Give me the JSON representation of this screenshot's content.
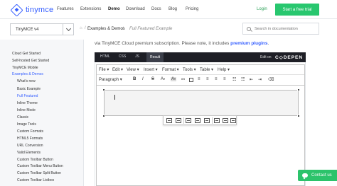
{
  "brand": {
    "name": "tinymce",
    "color": "#335dff",
    "accent": "#28c76f"
  },
  "nav": {
    "items": [
      "Features",
      "Extensions",
      "Demo",
      "Download",
      "Docs",
      "Blog",
      "Pricing"
    ],
    "active": "Demo",
    "login": "Login",
    "cta": "Start a free trial"
  },
  "sidebar": {
    "version": "TinyMCE v4",
    "items": [
      {
        "label": "Cloud Get Started",
        "level": 1
      },
      {
        "label": "Self-hosted Get Started",
        "level": 1
      },
      {
        "label": "TinyMCE Mobile",
        "level": 1
      },
      {
        "label": "Examples & Demos",
        "level": 1,
        "active": true
      },
      {
        "label": "What's new",
        "level": 2
      },
      {
        "label": "Basic Example",
        "level": 2
      },
      {
        "label": "Full Featured",
        "level": 2,
        "active": true
      },
      {
        "label": "Inline Theme",
        "level": 2
      },
      {
        "label": "Inline Mode",
        "level": 2
      },
      {
        "label": "Classic",
        "level": 2
      },
      {
        "label": "Image Tools",
        "level": 2
      },
      {
        "label": "Custom Formats",
        "level": 2
      },
      {
        "label": "HTML5 Formats",
        "level": 2
      },
      {
        "label": "URL Conversion",
        "level": 2
      },
      {
        "label": "Valid Elements",
        "level": 2
      },
      {
        "label": "Custom Toolbar Button",
        "level": 2
      },
      {
        "label": "Custom Toolbar Menu Button",
        "level": 2
      },
      {
        "label": "Custom Toolbar Split Button",
        "level": 2
      },
      {
        "label": "Custom Toolbar Listbox",
        "level": 2
      }
    ]
  },
  "breadcrumb": {
    "home_icon": "home-icon",
    "items": [
      "Examples & Demos",
      "Full Featured Example"
    ]
  },
  "search": {
    "placeholder": "Search in documentation"
  },
  "intro": {
    "text": "via TinyMCE Cloud premium subscription. Please note, it includes ",
    "link": "premium plugins",
    "end": "."
  },
  "codepen": {
    "tabs": [
      "HTML",
      "CSS",
      "JS",
      "Result"
    ],
    "active_tab": "Result",
    "edit_on": "Edit on",
    "logo": "C◇DEPEN"
  },
  "editor": {
    "menu": [
      "File",
      "Edit",
      "View",
      "Insert",
      "Format",
      "Tools",
      "Table",
      "Help"
    ],
    "block_format": "Paragraph",
    "toolbar": [
      "B",
      "I",
      "S",
      "A",
      "A"
    ]
  },
  "contact": {
    "label": "Contact us"
  }
}
